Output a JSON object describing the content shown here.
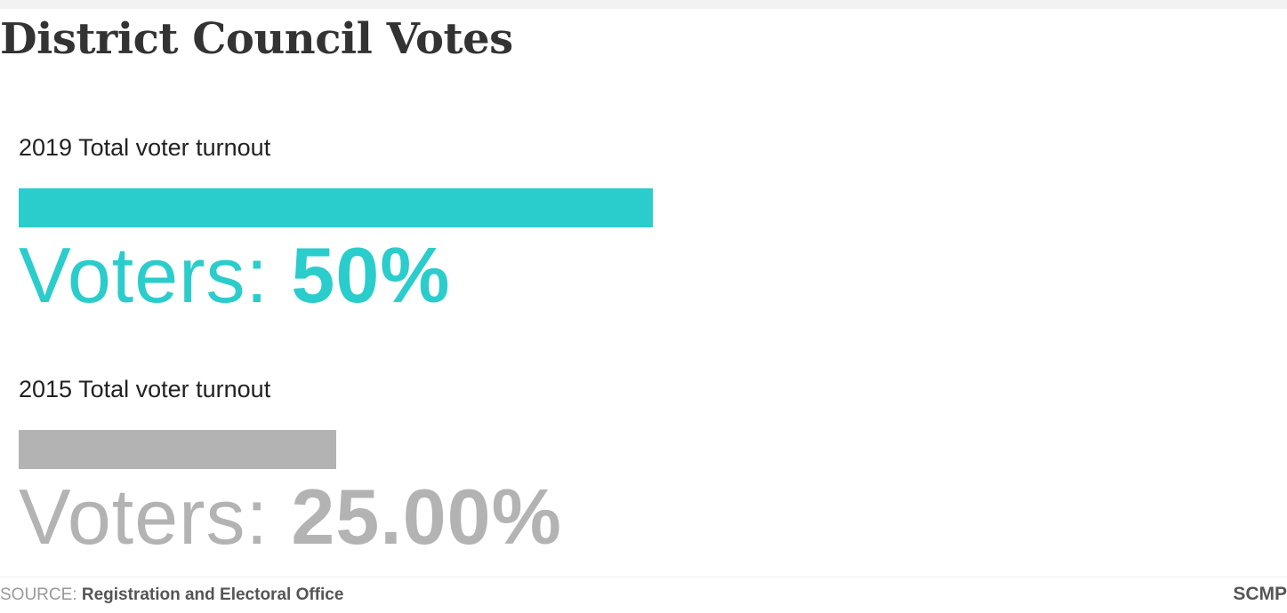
{
  "title": "District Council Votes",
  "colors": {
    "current": "#2bcccc",
    "previous": "#b3b3b3"
  },
  "chart_data": {
    "type": "bar",
    "title": "District Council Votes",
    "xlabel": "",
    "ylabel": "",
    "xlim": [
      0,
      100
    ],
    "series": [
      {
        "label": "2019 Total voter turnout",
        "value_prefix": "Voters: ",
        "value_text": "50%",
        "value": 50,
        "color": "#2bcccc"
      },
      {
        "label": "2015 Total voter turnout",
        "value_prefix": "Voters: ",
        "value_text": "25.00%",
        "value": 25,
        "color": "#b3b3b3"
      }
    ]
  },
  "footer": {
    "source_label": "SOURCE: ",
    "source_name": "Registration and Electoral Office",
    "brand": "SCMP"
  }
}
